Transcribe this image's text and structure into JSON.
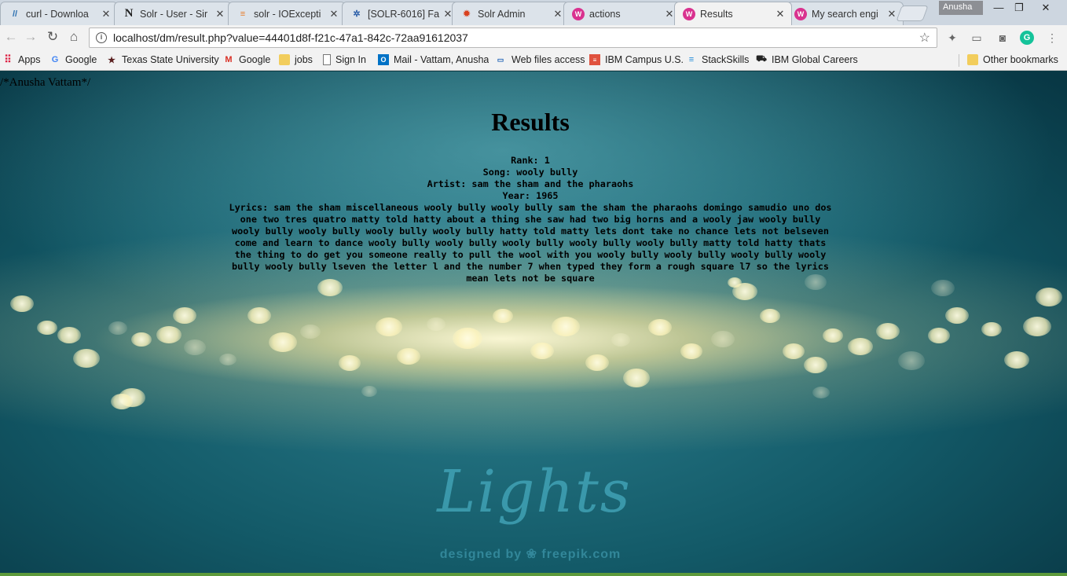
{
  "tabs": [
    {
      "title": "curl - Downloa",
      "icon": "curl-icon"
    },
    {
      "title": "Solr - User - Sir",
      "icon": "n-icon"
    },
    {
      "title": "solr - IOExcepti",
      "icon": "stackoverflow-icon"
    },
    {
      "title": "[SOLR-6016] Fa",
      "icon": "jira-icon"
    },
    {
      "title": "Solr Admin",
      "icon": "solr-icon"
    },
    {
      "title": "actions",
      "icon": "app-icon"
    },
    {
      "title": "Results",
      "icon": "app-icon"
    },
    {
      "title": "My search engi",
      "icon": "app-icon"
    }
  ],
  "active_tab": "Results",
  "profile_name": "Anusha",
  "address_bar": {
    "url": "localhost/dm/result.php?value=44401d8f-f21c-47a1-842c-72aa91612037"
  },
  "bookmarks": [
    {
      "label": "Apps",
      "icon": "apps-grid-icon"
    },
    {
      "label": "Google",
      "icon": "google-icon"
    },
    {
      "label": "Texas State University",
      "icon": "star-icon"
    },
    {
      "label": "Google",
      "icon": "gmail-icon"
    },
    {
      "label": "jobs",
      "icon": "folder-icon"
    },
    {
      "label": "Sign In",
      "icon": "page-icon"
    },
    {
      "label": "Mail - Vattam, Anusha",
      "icon": "outlook-icon"
    },
    {
      "label": "Web files access",
      "icon": "web-icon"
    },
    {
      "label": "IBM Campus U.S.",
      "icon": "ibm-icon"
    },
    {
      "label": "StackSkills",
      "icon": "stackskills-icon"
    },
    {
      "label": "IBM Global Careers",
      "icon": "car-icon"
    },
    {
      "label": "Other bookmarks",
      "icon": "folder-icon"
    }
  ],
  "page": {
    "comment": "/*Anusha Vattam*/",
    "heading": "Results",
    "result": {
      "rank": "Rank: 1",
      "song": "Song: wooly bully",
      "artist": "Artist: sam the sham and the pharaohs",
      "year": "Year: 1965",
      "lyrics": "Lyrics: sam the sham miscellaneous wooly bully wooly bully sam the sham  the pharaohs  domingo samudio uno dos one two tres quatro matty told hatty about a thing she saw had two big horns and a wooly jaw wooly bully wooly bully wooly bully wooly bully wooly bully hatty told matty lets dont take no chance lets not belseven come and learn to dance wooly bully wooly bully wooly bully wooly bully wooly bully matty told hatty thats the thing to do get you someone really to pull the wool with you wooly bully wooly bully wooly bully wooly bully wooly bully lseven  the letter l and the number 7 when typed they form a rough square l7 so the lyrics mean lets not be square"
    },
    "background_logo": "Lights",
    "background_credit": "designed by ❀ freepik.com"
  }
}
